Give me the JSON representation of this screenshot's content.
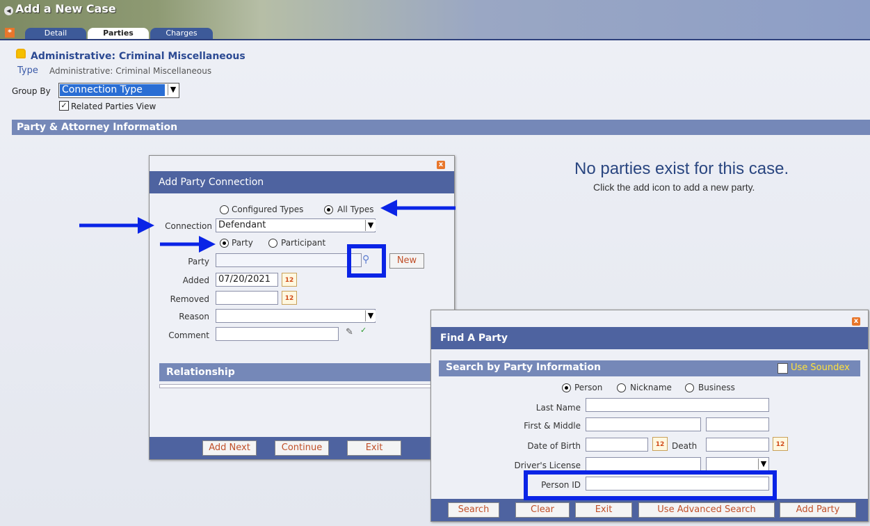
{
  "header": {
    "title": "Add a New Case",
    "tabs": [
      "Detail",
      "Parties",
      "Charges"
    ]
  },
  "case": {
    "title": "Administrative: Criminal Miscellaneous",
    "type_label": "Type",
    "type_value": "Administrative: Criminal Miscellaneous",
    "group_by_label": "Group By",
    "group_by_value": "Connection Type",
    "related_parties_label": "Related Parties View"
  },
  "section": {
    "title": "Party & Attorney Information"
  },
  "empty": {
    "title": "No parties exist for this case.",
    "subtitle": "Click the add icon to add a new party."
  },
  "add_party": {
    "title": "Add Party Connection",
    "radio_configured": "Configured Types",
    "radio_all": "All Types",
    "connection_label": "Connection",
    "connection_value": "Defendant",
    "radio_party": "Party",
    "radio_participant": "Participant",
    "party_label": "Party",
    "new_label": "New",
    "added_label": "Added",
    "added_value": "07/20/2021",
    "removed_label": "Removed",
    "reason_label": "Reason",
    "comment_label": "Comment",
    "relationship_title": "Relationship",
    "btn_add_next": "Add Next",
    "btn_continue": "Continue",
    "btn_exit": "Exit"
  },
  "find_party": {
    "title": "Find A Party",
    "section_title": "Search by Party Information",
    "soundex_label": "Use Soundex",
    "radio_person": "Person",
    "radio_nickname": "Nickname",
    "radio_business": "Business",
    "last_name_label": "Last Name",
    "first_middle_label": "First & Middle",
    "dob_label": "Date of Birth",
    "death_label": "Death",
    "drivers_license_label": "Driver's License",
    "person_id_label": "Person ID",
    "btn_search": "Search",
    "btn_clear": "Clear",
    "btn_exit": "Exit",
    "btn_advanced": "Use Advanced Search",
    "btn_add_party": "Add Party"
  },
  "colors": {
    "highlight": "#0a24e6",
    "titlebar": "#4e63a0",
    "section": "#7588b8"
  }
}
